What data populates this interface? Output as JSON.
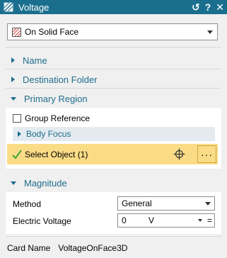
{
  "window": {
    "title": "Voltage",
    "controls": {
      "reset": "↺",
      "help": "?",
      "close": "✕"
    }
  },
  "type_selector": {
    "value": "On Solid Face",
    "icon": "solid-face-icon"
  },
  "sections": {
    "name": "Name",
    "destination_folder": "Destination Folder",
    "primary_region": "Primary Region",
    "magnitude": "Magnitude"
  },
  "primary_region": {
    "group_reference_label": "Group Reference",
    "body_focus_label": "Body Focus",
    "select_object_label": "Select Object (1)",
    "more_label": "···"
  },
  "magnitude": {
    "method_label": "Method",
    "method_value": "General",
    "electric_voltage_label": "Electric Voltage",
    "voltage_value": "0",
    "voltage_unit": "V",
    "equals_symbol": "="
  },
  "card_name": {
    "label": "Card Name",
    "value": "VoltageOnFace3D"
  },
  "colors": {
    "titlebar": "#1a6f8e",
    "section_text": "#1e6d8c",
    "highlight": "#fbdc86"
  }
}
